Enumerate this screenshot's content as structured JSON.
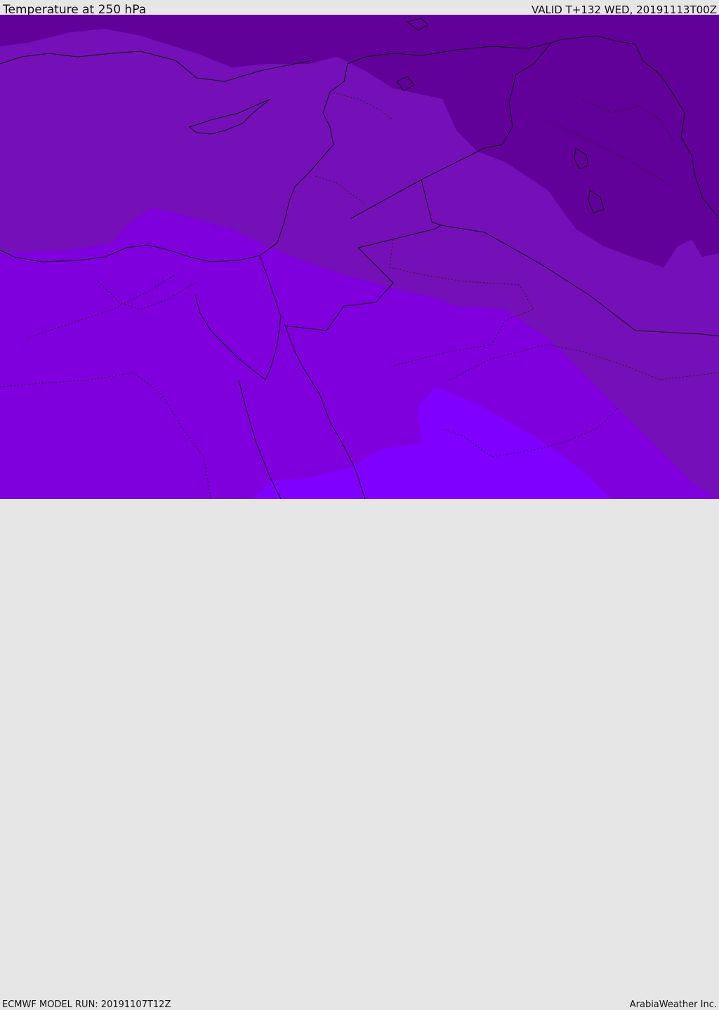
{
  "header": {
    "title": "Temperature at 250 hPa",
    "valid": "VALID T+132 WED, 20191113T00Z"
  },
  "footer": {
    "model_run": "ECMWF MODEL RUN: 20191107T12Z",
    "credit": "ArabiaWeather Inc."
  },
  "palette": {
    "coldest": "#62009a",
    "cold": "#7510b8",
    "mild": "#7f00dd",
    "warm": "#8000ff",
    "border": "#111111"
  }
}
